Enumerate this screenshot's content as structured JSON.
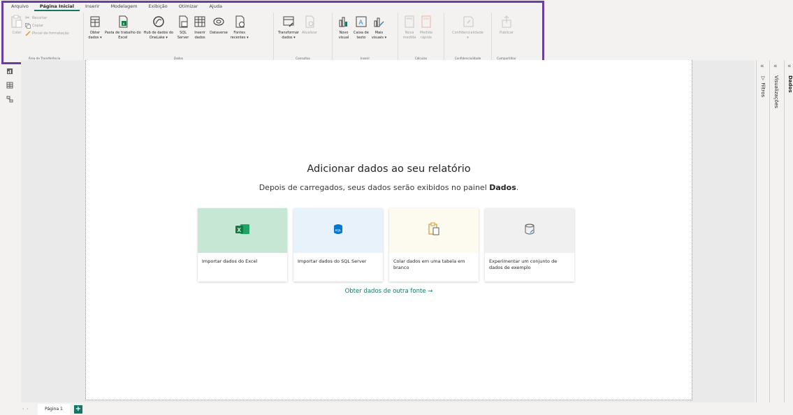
{
  "menu": {
    "tabs": [
      "Arquivo",
      "Página Inicial",
      "Inserir",
      "Modelagem",
      "Exibição",
      "Otimizar",
      "Ajuda"
    ],
    "active_index": 1
  },
  "ribbon": {
    "clipboard": {
      "label": "Área de Transferência",
      "paste": "Colar",
      "cut": "Recortar",
      "copy": "Copiar",
      "format_painter": "Pincel de formatação"
    },
    "data": {
      "label": "Dados",
      "get_data": "Obter\ndados ▾",
      "excel": "Pasta de trabalho do\nExcel",
      "onelake": "Hub de dados do\nOneLake ▾",
      "sql": "SQL\nServer",
      "enter_data": "Inserir\ndados",
      "dataverse": "Dataverse",
      "recent": "Fontes\nrecentes ▾"
    },
    "queries": {
      "label": "Consultas",
      "transform": "Transformar\ndados ▾",
      "refresh": "Atualizar"
    },
    "insert": {
      "label": "Inserir",
      "new_visual": "Novo\nvisual",
      "text_box": "Caixa de\ntexto",
      "more_visuals": "Mais\nvisuais ▾"
    },
    "calculations": {
      "label": "Cálculos",
      "new_measure": "Nova\nmedida",
      "quick_measure": "Medida\nrápida"
    },
    "sensitivity": {
      "label": "Confidencialidade",
      "button": "Confidencialidade\n▾"
    },
    "share": {
      "label": "Compartilhar",
      "publish": "Publicar"
    }
  },
  "main": {
    "title": "Adicionar dados ao seu relatório",
    "subtitle_prefix": "Depois de carregados, seus dados serão exibidos no painel ",
    "subtitle_bold": "Dados",
    "subtitle_suffix": ".",
    "cards": [
      {
        "text": "Importar dados do Excel",
        "bg": "#c6e7d4"
      },
      {
        "text": "Importar dados do SQL Server",
        "bg": "#e8f2fb"
      },
      {
        "text": "Colar dados em uma tabela em branco",
        "bg": "#fdfbef"
      },
      {
        "text": "Experimentar um conjunto de dados de exemplo",
        "bg": "#f0f0f0"
      }
    ],
    "other_source": "Obter dados de outra fonte →"
  },
  "panes": {
    "filters": "Filtros",
    "visualizations": "Visualizações",
    "data": "Dados"
  },
  "pages": {
    "current": "Página 1",
    "add": "+"
  },
  "colors": {
    "accent": "#117865",
    "highlight": "#6b3fa0"
  }
}
